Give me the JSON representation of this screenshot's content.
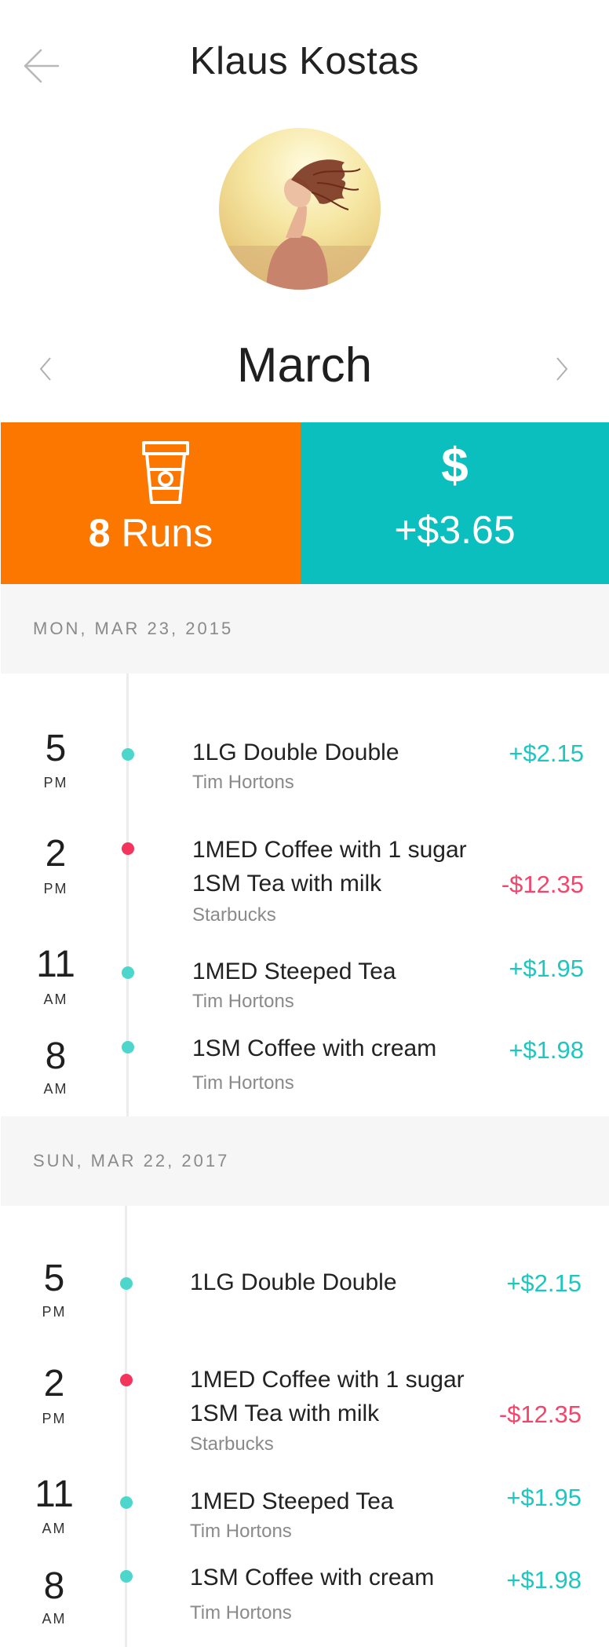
{
  "header": {
    "title": "Klaus Kostas"
  },
  "month": {
    "label": "March"
  },
  "stats": {
    "runs_count": "8",
    "runs_label": " Runs",
    "balance_symbol": "$",
    "balance": "+$3.65"
  },
  "days": [
    {
      "label": "MON, MAR 23, 2015",
      "entries": [
        {
          "hour": "5",
          "ampm": "PM",
          "items": [
            "1LG Double Double"
          ],
          "vendor": "Tim Hortons",
          "amount": "+$2.15"
        },
        {
          "hour": "2",
          "ampm": "PM",
          "items": [
            "1MED Coffee with 1 sugar",
            "1SM Tea with milk"
          ],
          "vendor": "Starbucks",
          "amount": "-$12.35"
        },
        {
          "hour": "11",
          "ampm": "AM",
          "items": [
            "1MED Steeped Tea"
          ],
          "vendor": "Tim Hortons",
          "amount": "+$1.95"
        },
        {
          "hour": "8",
          "ampm": "AM",
          "items": [
            "1SM Coffee with cream"
          ],
          "vendor": "Tim Hortons",
          "amount": "+$1.98"
        }
      ]
    },
    {
      "label": "SUN, MAR 22, 2017",
      "entries": [
        {
          "hour": "5",
          "ampm": "PM",
          "items": [
            "1LG Double Double"
          ],
          "vendor": "",
          "amount": "+$2.15"
        },
        {
          "hour": "2",
          "ampm": "PM",
          "items": [
            "1MED Coffee with 1 sugar",
            "1SM Tea with milk"
          ],
          "vendor": "Starbucks",
          "amount": "-$12.35"
        },
        {
          "hour": "11",
          "ampm": "AM",
          "items": [
            "1MED Steeped Tea"
          ],
          "vendor": "Tim Hortons",
          "amount": "+$1.95"
        },
        {
          "hour": "8",
          "ampm": "AM",
          "items": [
            "1SM Coffee with cream"
          ],
          "vendor": "Tim Hortons",
          "amount": "+$1.98"
        }
      ]
    }
  ],
  "colors": {
    "orange": "#fb7700",
    "teal": "#0bbfbf",
    "positive": "#1ec6c0",
    "negative": "#f5446a",
    "dot_positive": "#4dd6cc",
    "dot_negative": "#f5345d"
  },
  "icons": {
    "back": "arrow-left-icon",
    "prev": "chevron-left-icon",
    "next": "chevron-right-icon",
    "cup": "coffee-cup-icon"
  }
}
